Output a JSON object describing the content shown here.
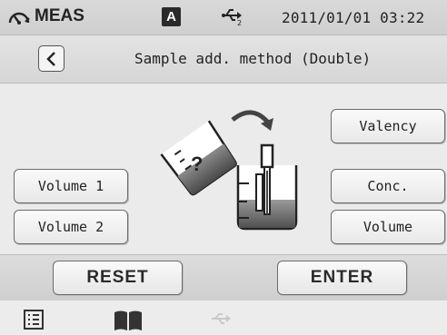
{
  "status": {
    "mode_label": "MEAS",
    "mode_icon": "gauge-icon",
    "badge": "A",
    "usb_icon": "usb-icon",
    "datetime": "2011/01/01 03:22"
  },
  "header": {
    "back_icon": "chevron-left-icon",
    "title": "Sample add. method (Double)"
  },
  "buttons": {
    "volume1": "Volume 1",
    "volume2": "Volume 2",
    "valency": "Valency",
    "conc": "Conc.",
    "volume": "Volume"
  },
  "illustration": {
    "beaker_label": "?"
  },
  "footer": {
    "reset": "RESET",
    "enter": "ENTER"
  },
  "nav": {
    "icons": [
      "list-icon",
      "book-icon",
      "usb-icon"
    ],
    "disabled_color": "#c9c9c9"
  }
}
